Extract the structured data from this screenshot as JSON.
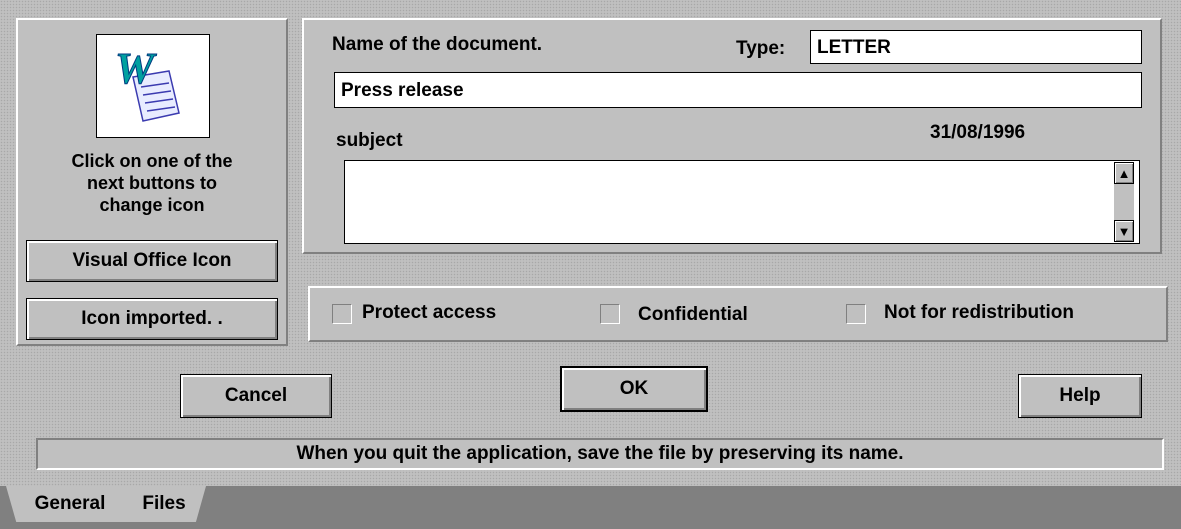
{
  "document": {
    "name_label": "Name of the document.",
    "type_label": "Type:",
    "type_value": "LETTER",
    "name_value": "Press release",
    "subject_label": "subject",
    "date": "31/08/1996",
    "subject_value": ""
  },
  "icon_panel": {
    "icon_name": "word-document-icon",
    "instruction": [
      "Click on one of the",
      "next buttons to",
      "change icon"
    ],
    "visual_office_button": "Visual Office Icon",
    "imported_button": "Icon imported. ."
  },
  "options": {
    "protect_access": "Protect access",
    "confidential": "Confidential",
    "not_for_redistribution": "Not for redistribution"
  },
  "buttons": {
    "cancel": "Cancel",
    "ok": "OK",
    "help": "Help"
  },
  "status": "When you quit the application, save the file by preserving its name.",
  "tabs": [
    "General",
    "Files"
  ],
  "scroll": {
    "up_icon": "arrow-up-icon",
    "down_icon": "arrow-down-icon"
  }
}
